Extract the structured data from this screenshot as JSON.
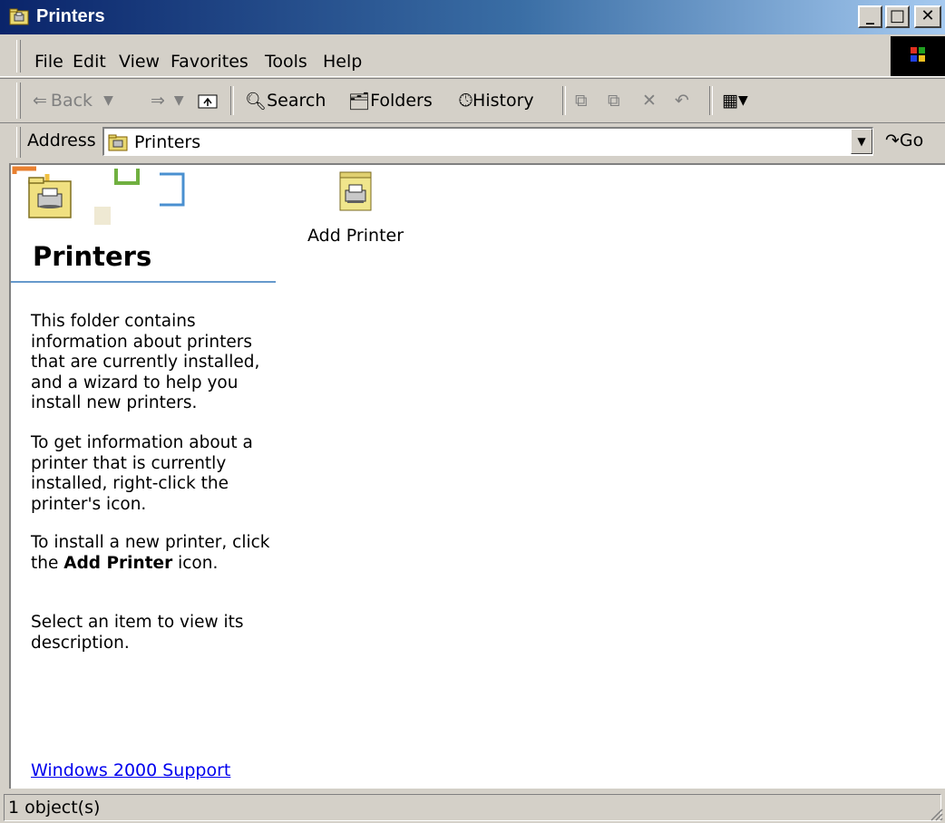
{
  "window": {
    "title": "Printers",
    "icon": "printers-folder-icon"
  },
  "menu": {
    "file": "File",
    "edit": "Edit",
    "view": "View",
    "favorites": "Favorites",
    "tools": "Tools",
    "help": "Help"
  },
  "toolbar": {
    "back": "Back",
    "search": "Search",
    "folders": "Folders",
    "history": "History"
  },
  "address": {
    "label": "Address",
    "value": "Printers",
    "go": "Go"
  },
  "webview": {
    "title": "Printers",
    "para1": "This folder contains information about printers that are currently installed, and a wizard to help you install new printers.",
    "para2": "To get information about a printer that is currently installed, right-click the printer's icon.",
    "para3_pre": "To install a new printer, click the ",
    "para3_bold": "Add Printer",
    "para3_post": " icon.",
    "para4": "Select an item to view its description.",
    "support_link": "Windows 2000 Support"
  },
  "items": [
    {
      "label": "Add Printer",
      "icon": "add-printer-icon"
    }
  ],
  "status": {
    "text": "1 object(s)"
  },
  "colors": {
    "title_start": "#0a246a",
    "title_end": "#a6caf0",
    "link": "#0000ee",
    "rule": "#6699cc"
  }
}
